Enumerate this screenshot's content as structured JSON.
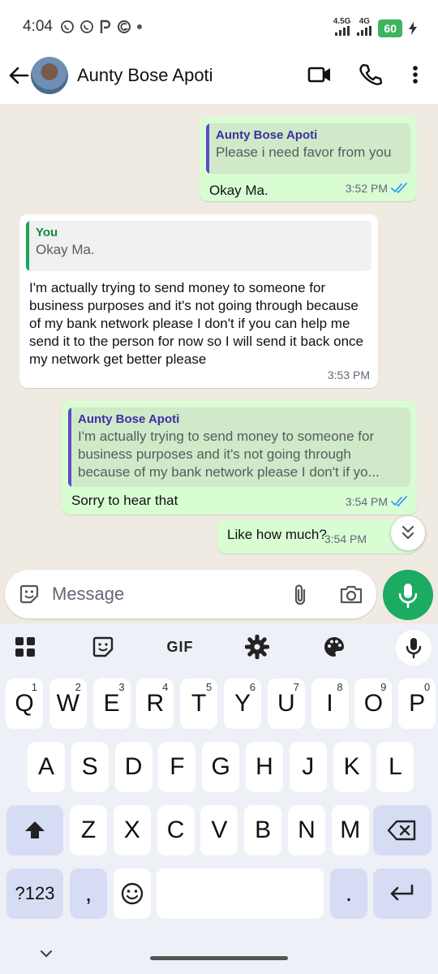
{
  "status_bar": {
    "time": "4:04",
    "network_1": "4.5G",
    "network_2": "4G",
    "battery": "60"
  },
  "header": {
    "contact_name": "Aunty Bose Apoti"
  },
  "messages": [
    {
      "direction": "outgoing",
      "quote_author": "Aunty Bose Apoti",
      "quote_text": "Please i need favor from you",
      "text": "Okay Ma.",
      "time": "3:52 PM",
      "status": "read"
    },
    {
      "direction": "incoming",
      "quote_author": "You",
      "quote_text": "Okay Ma.",
      "text": "I'm actually trying to send money to someone for business  purposes and it's not going through because of my bank network please I don't if you can help me send it to the person for now so I will send it back once my network get better please",
      "time": "3:53 PM"
    },
    {
      "direction": "outgoing",
      "quote_author": "Aunty Bose Apoti",
      "quote_text": "I'm actually trying to send money to someone for business  purposes and it's not going through because of my bank network please I don't if yo...",
      "text": "Sorry to hear that",
      "time": "3:54 PM",
      "status": "read"
    },
    {
      "direction": "outgoing",
      "text": "Like how much?",
      "time": "3:54 PM",
      "status": "sent"
    }
  ],
  "composer": {
    "placeholder": "Message"
  },
  "keyboard": {
    "gif_label": "GIF",
    "row1": [
      {
        "letter": "Q",
        "num": "1"
      },
      {
        "letter": "W",
        "num": "2"
      },
      {
        "letter": "E",
        "num": "3"
      },
      {
        "letter": "R",
        "num": "4"
      },
      {
        "letter": "T",
        "num": "5"
      },
      {
        "letter": "Y",
        "num": "6"
      },
      {
        "letter": "U",
        "num": "7"
      },
      {
        "letter": "I",
        "num": "8"
      },
      {
        "letter": "O",
        "num": "9"
      },
      {
        "letter": "P",
        "num": "0"
      }
    ],
    "row2": [
      "A",
      "S",
      "D",
      "F",
      "G",
      "H",
      "J",
      "K",
      "L"
    ],
    "row3": [
      "Z",
      "X",
      "C",
      "V",
      "B",
      "N",
      "M"
    ],
    "symbols_label": "?123",
    "comma": ",",
    "period": "."
  }
}
